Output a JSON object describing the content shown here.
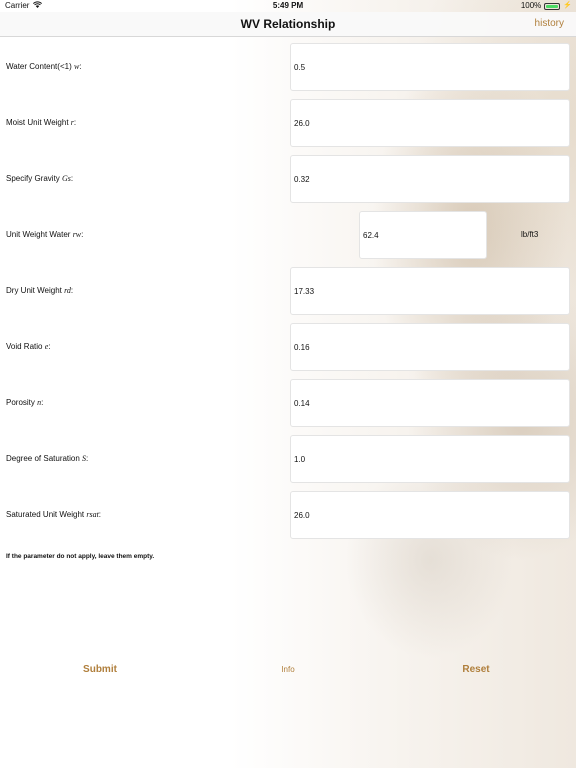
{
  "status_bar": {
    "carrier": "Carrier",
    "time": "5:49 PM",
    "battery": "100%",
    "battery_level": 1.0
  },
  "nav": {
    "title": "WV Relationship",
    "history_label": "history"
  },
  "fields": [
    {
      "label": "Water Content(<1) ",
      "symbol": "w",
      "suffix": ":",
      "value": "0.5"
    },
    {
      "label": "Moist Unit Weight ",
      "symbol": "r",
      "suffix": ":",
      "value": "26.0"
    },
    {
      "label": "Specify Gravity ",
      "symbol": "Gs",
      "suffix": ":",
      "value": "0.32"
    },
    {
      "label": "Unit Weight Water ",
      "symbol": "rw",
      "suffix": ":",
      "value": "62.4",
      "unit": "lb/ft3"
    },
    {
      "label": "Dry Unit Weight ",
      "symbol": "rd",
      "suffix": ":",
      "value": "17.33"
    },
    {
      "label": "Void Ratio ",
      "symbol": "e",
      "suffix": ":",
      "value": "0.16"
    },
    {
      "label": "Porosity ",
      "symbol": "n",
      "suffix": ":",
      "value": "0.14"
    },
    {
      "label": "Degree of Saturation ",
      "symbol": "S",
      "suffix": ":",
      "value": "1.0"
    },
    {
      "label": "Saturated Unit Weight ",
      "symbol": "rsat",
      "suffix": ":",
      "value": "26.0"
    }
  ],
  "note": "If the parameter do not apply, leave them empty.",
  "buttons": {
    "submit": "Submit",
    "info": "Info",
    "reset": "Reset"
  },
  "colors": {
    "accent": "#b07f3c",
    "battery": "#4cd964"
  },
  "icons": {
    "wifi": "wifi-icon",
    "charging": "charging-bolt-icon"
  }
}
